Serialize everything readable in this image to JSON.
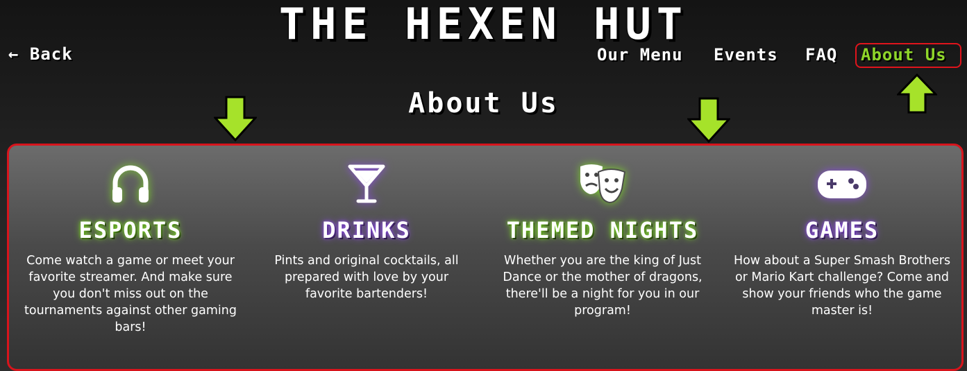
{
  "site": {
    "title": "THE HEXEN HUT"
  },
  "back": {
    "label": "← Back"
  },
  "nav": {
    "items": [
      {
        "label": "Our Menu",
        "active": false
      },
      {
        "label": "Events",
        "active": false
      },
      {
        "label": "FAQ",
        "active": false
      },
      {
        "label": "About Us",
        "active": true
      }
    ]
  },
  "page": {
    "title": "About Us"
  },
  "features": [
    {
      "icon": "headphones-icon",
      "title": "ESPORTS",
      "glow": "#7cd12b",
      "description": "Come watch a game or meet your favorite streamer. And make sure you don't miss out on the tournaments against other gaming bars!"
    },
    {
      "icon": "cocktail-icon",
      "title": "DRINKS",
      "glow": "#8b4fe0",
      "description": "Pints and original cocktails, all prepared with love by your favorite bartenders!"
    },
    {
      "icon": "theater-masks-icon",
      "title": "THEMED NIGHTS",
      "glow": "#7cd12b",
      "description": "Whether you are the king of Just Dance or the mother of dragons, there'll be a night for you in our program!"
    },
    {
      "icon": "gamepad-icon",
      "title": "GAMES",
      "glow": "#8b4fe0",
      "description": "How about a Super Smash Brothers or Mario Kart challenge? Come and show your friends who the game master is!"
    }
  ],
  "annotations": {
    "arrow_color": "#a6e22a",
    "highlight_color": "#e0141c"
  }
}
